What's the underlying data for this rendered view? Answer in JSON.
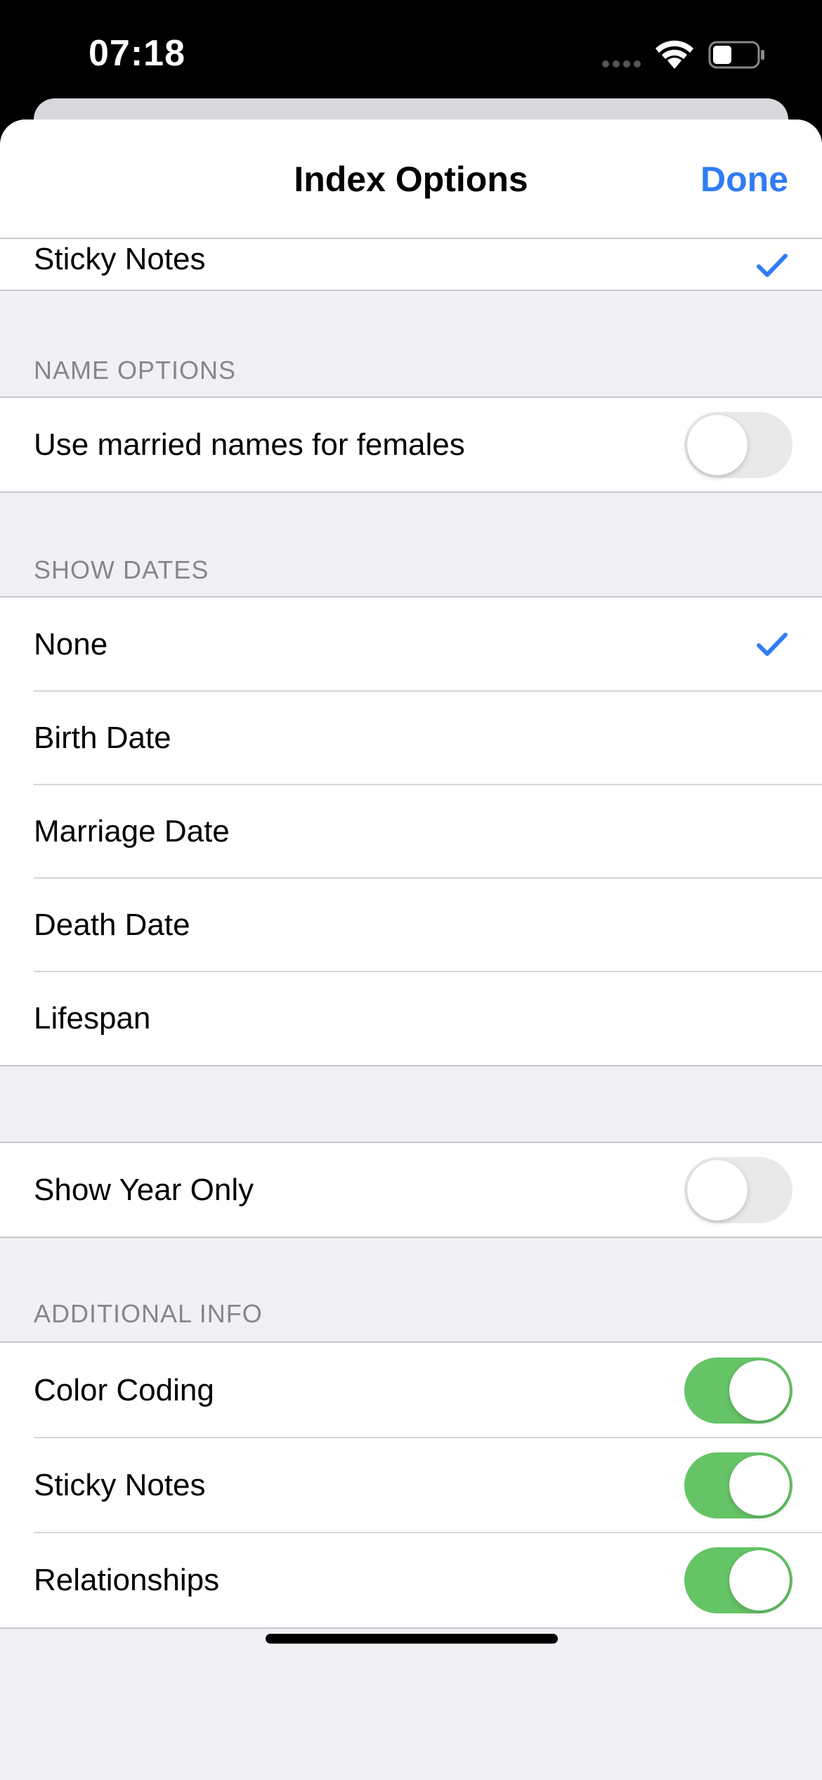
{
  "status_bar": {
    "time": "07:18"
  },
  "nav": {
    "title": "Index Options",
    "done_label": "Done"
  },
  "top_partial_row": {
    "label": "Sticky Notes",
    "checked": true
  },
  "name_options": {
    "header": "NAME OPTIONS",
    "married_names": {
      "label": "Use married names for females",
      "on": false
    }
  },
  "show_dates": {
    "header": "SHOW DATES",
    "items": [
      {
        "label": "None",
        "checked": true
      },
      {
        "label": "Birth Date",
        "checked": false
      },
      {
        "label": "Marriage Date",
        "checked": false
      },
      {
        "label": "Death Date",
        "checked": false
      },
      {
        "label": "Lifespan",
        "checked": false
      }
    ]
  },
  "year_only": {
    "label": "Show Year Only",
    "on": false
  },
  "additional_info": {
    "header": "ADDITIONAL INFO",
    "items": [
      {
        "label": "Color Coding",
        "on": true
      },
      {
        "label": "Sticky Notes",
        "on": true
      },
      {
        "label": "Relationships",
        "on": true
      }
    ]
  },
  "colors": {
    "accent": "#2f7cf6",
    "toggle_on": "#65c466",
    "toggle_off": "#e9e9ea",
    "grouped_background": "#f0f0f5"
  }
}
